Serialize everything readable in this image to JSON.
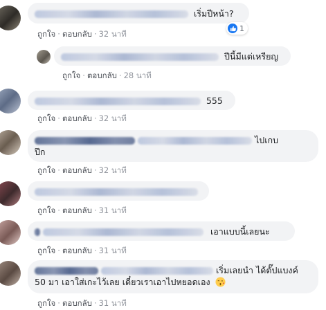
{
  "comments": [
    {
      "text": "เริ่มปีหน้า?",
      "reaction_count": "1",
      "actions": {
        "like": "ถูกใจ",
        "reply": "ตอบกลับ",
        "time": "32 นาที"
      }
    },
    {
      "text": "ปีนี้มีแต่เหรียญ",
      "actions": {
        "like": "ถูกใจ",
        "reply": "ตอบกลับ",
        "time": "28 นาที"
      }
    },
    {
      "text": "555",
      "actions": {
        "like": "ถูกใจ",
        "reply": "ตอบกลับ",
        "time": "32 นาที"
      }
    },
    {
      "text": "ไปเกบ",
      "text2": "ปึก",
      "actions": {
        "like": "ถูกใจ",
        "reply": "ตอบกลับ",
        "time": "32 นาที"
      }
    },
    {
      "actions": {
        "like": "ถูกใจ",
        "reply": "ตอบกลับ",
        "time": "31 นาที"
      }
    },
    {
      "text": "เอาแบบนี้เลยนะ",
      "actions": {
        "like": "ถูกใจ",
        "reply": "ตอบกลับ",
        "time": "31 นาที"
      }
    },
    {
      "text": "เริ่มเลยนำ ได้ตั๊ปแบงค์",
      "text2": "50 มา เอาใส่เกะไว้เลย เดี๋ยวเราเอาไปหยอดเอง",
      "actions": {
        "like": "ถูกใจ",
        "reply": "ตอบกลับ",
        "time": "31 นาที"
      }
    }
  ],
  "colors": {
    "bubble": "#f2f3f5",
    "link": "#4b4f56",
    "meta": "#90949c",
    "like_blue": "#1877f2"
  },
  "icons": {
    "reaction": "like-icon",
    "emoji": "kiss-emoji-icon"
  }
}
